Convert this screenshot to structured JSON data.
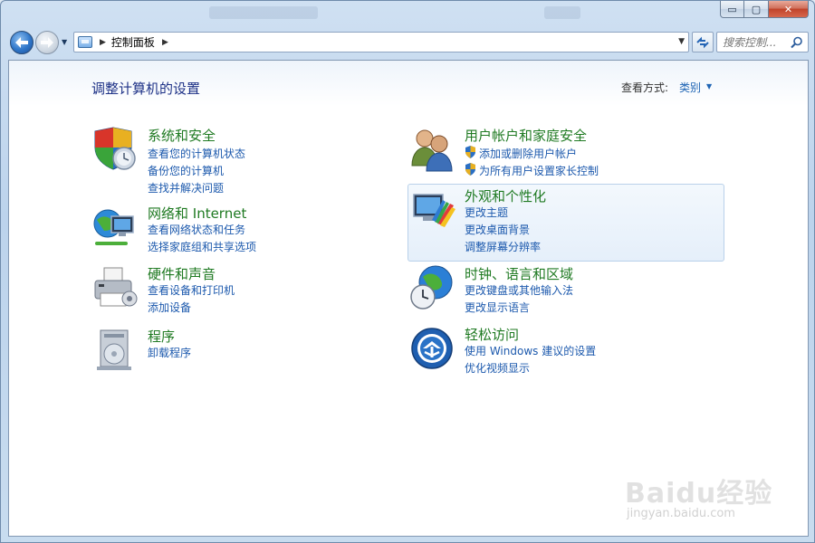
{
  "window": {
    "controls": {
      "minimize": "▭",
      "maximize": "▢",
      "close": "✕"
    }
  },
  "address_bar": {
    "path": "控制面板",
    "search_placeholder": "搜索控制..."
  },
  "header": {
    "title": "调整计算机的设置",
    "view_label": "查看方式:",
    "view_value": "类别"
  },
  "categories": [
    {
      "title": "系统和安全",
      "icon": "shield-icon",
      "links": [
        "查看您的计算机状态",
        "备份您的计算机",
        "查找并解决问题"
      ]
    },
    {
      "title": "网络和 Internet",
      "icon": "network-icon",
      "links": [
        "查看网络状态和任务",
        "选择家庭组和共享选项"
      ]
    },
    {
      "title": "硬件和声音",
      "icon": "printer-icon",
      "links": [
        "查看设备和打印机",
        "添加设备"
      ]
    },
    {
      "title": "程序",
      "icon": "programs-icon",
      "links": [
        "卸载程序"
      ]
    },
    {
      "title": "用户帐户和家庭安全",
      "icon": "users-icon",
      "links": [
        "添加或删除用户帐户",
        "为所有用户设置家长控制"
      ]
    },
    {
      "title": "外观和个性化",
      "icon": "appearance-icon",
      "links": [
        "更改主题",
        "更改桌面背景",
        "调整屏幕分辨率"
      ]
    },
    {
      "title": "时钟、语言和区域",
      "icon": "clock-globe-icon",
      "links": [
        "更改键盘或其他输入法",
        "更改显示语言"
      ]
    },
    {
      "title": "轻松访问",
      "icon": "ease-of-access-icon",
      "links": [
        "使用 Windows 建议的设置",
        "优化视频显示"
      ]
    }
  ],
  "watermark": {
    "logo": "Baidu经验",
    "url": "jingyan.baidu.com"
  }
}
